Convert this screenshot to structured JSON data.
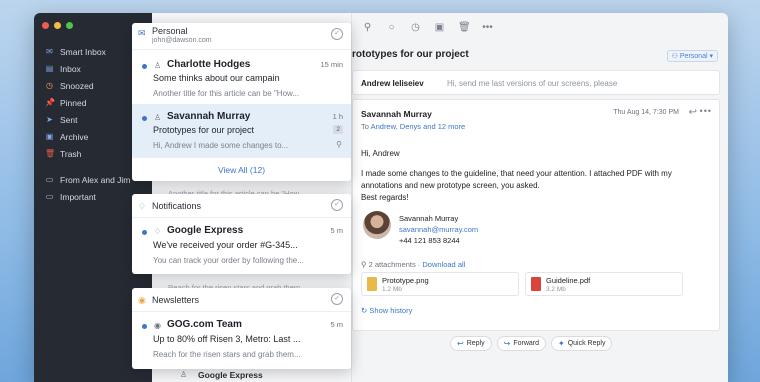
{
  "sidebar": {
    "items": [
      {
        "icon": "inbox-stack-icon",
        "glyph": "✉",
        "color": "#7fa8e8",
        "label": "Smart Inbox"
      },
      {
        "icon": "inbox-icon",
        "glyph": "▤",
        "color": "#7fa8e8",
        "label": "Inbox"
      },
      {
        "icon": "clock-icon",
        "glyph": "◷",
        "color": "#e9a64a",
        "label": "Snoozed"
      },
      {
        "icon": "pin-icon",
        "glyph": "📌",
        "color": "#e05b4b",
        "label": "Pinned"
      },
      {
        "icon": "send-icon",
        "glyph": "➤",
        "color": "#7fa8e8",
        "label": "Sent"
      },
      {
        "icon": "archive-icon",
        "glyph": "▣",
        "color": "#7fa8e8",
        "label": "Archive"
      },
      {
        "icon": "trash-icon",
        "glyph": "🗑",
        "color": "#e05b4b",
        "label": "Trash"
      }
    ],
    "folders": [
      {
        "icon": "folder-icon",
        "glyph": "▭",
        "color": "#c9ced6",
        "label": "From Alex and Jim"
      },
      {
        "icon": "folder-icon",
        "glyph": "▭",
        "color": "#c9ced6",
        "label": "Important"
      }
    ]
  },
  "list_ghost": {
    "row1_preview": "Another title for this article can be \"How...",
    "row2_preview": "Reach for the risen stars and grab them...",
    "row3_sender": "Google Express"
  },
  "reader": {
    "subject": "rototypes for our project",
    "account": "Personal",
    "collapsed": {
      "from": "Andrew Ieliseiev",
      "snippet": "Hi, send me last versions of our screens, please"
    },
    "message": {
      "from": "Savannah Murray",
      "date": "Thu Aug 14, 7:30 PM",
      "to_prefix": "To",
      "to_link": "Andrew, Denys and 12 more",
      "greeting": "Hi, Andrew",
      "body": "I made some changes to the guideline, that need your attention. I attached PDF with my annotations and new prototype screen, you asked.",
      "closing": "Best regards!",
      "sig_name": "Savannah Murray",
      "sig_email": "savannah@murray.com",
      "sig_phone": "+44 121 853 8244",
      "attach_count": "2 attachments",
      "download_all": "Download all",
      "attachments": [
        {
          "name": "Prototype.png",
          "size": "1.2 Mb",
          "color": "#e9b949"
        },
        {
          "name": "Guideline.pdf",
          "size": "3.2 Mb",
          "color": "#d9453a"
        }
      ],
      "history": "Show history"
    },
    "actions": [
      {
        "icon": "reply-icon",
        "glyph": "↩",
        "label": "Reply"
      },
      {
        "icon": "forward-icon",
        "glyph": "↪",
        "label": "Forward"
      },
      {
        "icon": "quick-reply-icon",
        "glyph": "✦",
        "label": "Quick Reply"
      }
    ]
  },
  "popovers": {
    "personal": {
      "title": "Personal",
      "email": "john@dawson.com",
      "items": [
        {
          "sender": "Charlotte Hodges",
          "time": "15 min",
          "subject": "Some thinks about our campain",
          "preview": "Another title for this article can be \"How..."
        },
        {
          "sender": "Savannah Murray",
          "time": "1 h",
          "badge": "2",
          "subject": "Prototypes for our project",
          "preview": "Hi, Andrew I made some changes to..."
        }
      ],
      "view_all": "View All (12)"
    },
    "notifications": {
      "title": "Notifications",
      "item": {
        "sender": "Google Express",
        "time": "5 m",
        "subject": "We've received your order #G-345...",
        "preview": "You can track your order by following the..."
      }
    },
    "newsletters": {
      "title": "Newsletters",
      "item": {
        "sender": "GOG.com Team",
        "time": "5 m",
        "subject": "Up to 80% off Risen 3, Metro: Last ...",
        "preview": "Reach for the risen stars and grab them..."
      }
    }
  }
}
